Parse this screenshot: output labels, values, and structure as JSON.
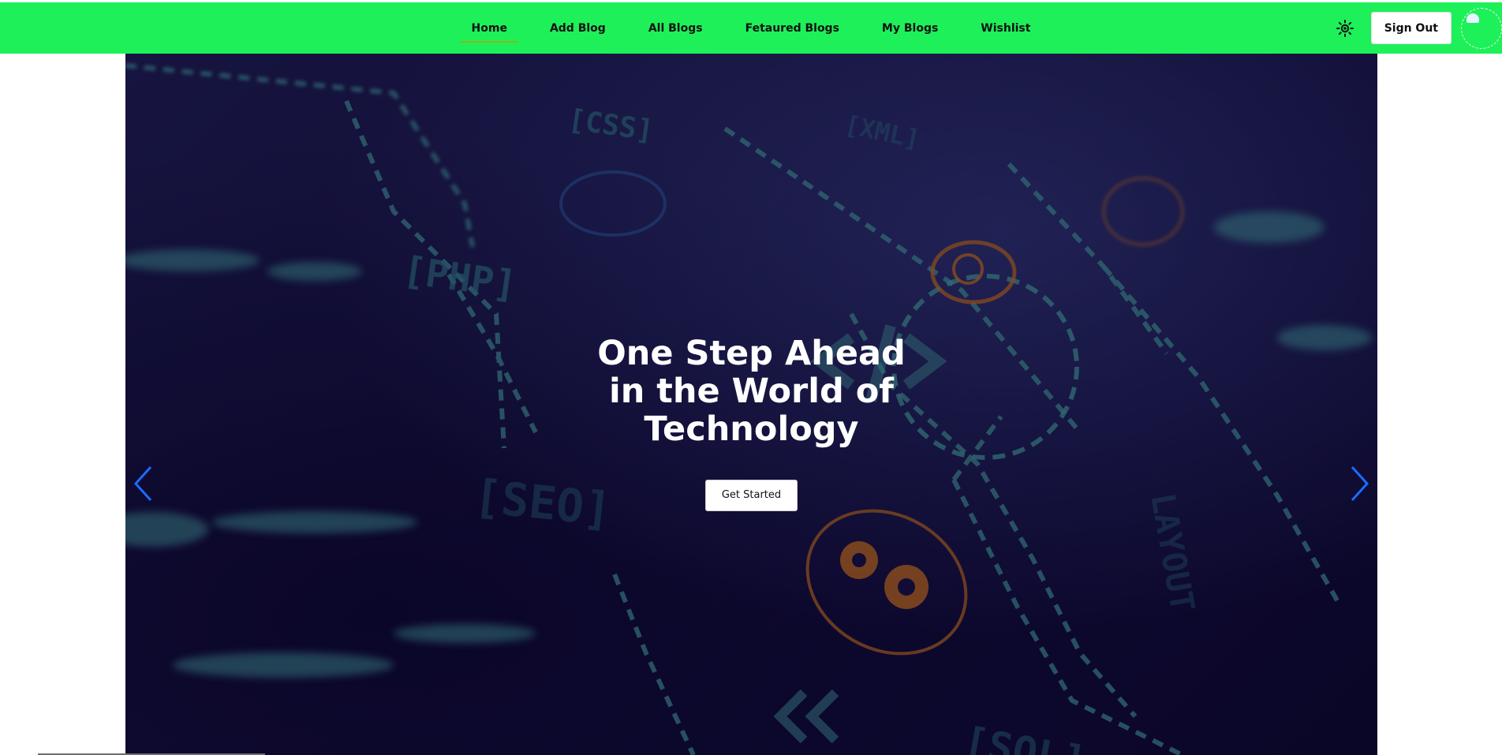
{
  "nav": {
    "links": [
      {
        "label": "Home",
        "active": true
      },
      {
        "label": "Add Blog"
      },
      {
        "label": "All Blogs"
      },
      {
        "label": "Fetaured Blogs"
      },
      {
        "label": "My Blogs"
      },
      {
        "label": "Wishlist"
      }
    ],
    "theme_icon": "sun-icon",
    "signout_label": "Sign Out",
    "avatar_icon": "user-avatar"
  },
  "hero": {
    "title": "One Step Ahead in the World of Technology",
    "button_label": "Get Started",
    "prev_icon": "chevron-left-icon",
    "next_icon": "chevron-right-icon",
    "background_tags": [
      "[CSS]",
      "[XML]",
      "[PHP]",
      "[SEO]",
      "[SQL]",
      "LAYOUT",
      "</>"
    ]
  },
  "colors": {
    "navbar_bg": "#1ef05a",
    "active_underline": "#8db80f",
    "hero_bg": "#140f3c",
    "circuit": "#3f8f8f",
    "arrow": "#1a6cff",
    "orange_accent": "#b8661a"
  }
}
